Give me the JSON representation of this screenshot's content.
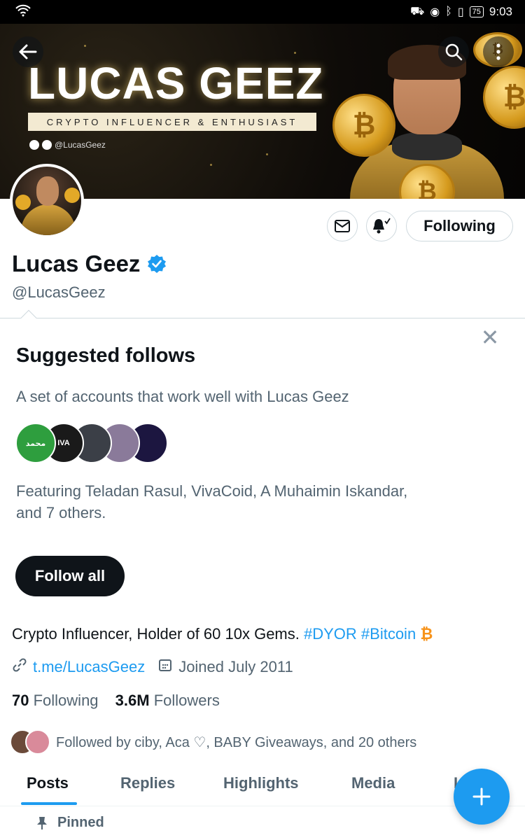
{
  "status_bar": {
    "battery": "75",
    "time": "9:03"
  },
  "banner": {
    "title": "LUCAS GEEZ",
    "tagline": "CRYPTO INFLUENCER & ENTHUSIAST",
    "social_handle": "@LucasGeez"
  },
  "profile": {
    "name": "Lucas Geez",
    "handle": "@LucasGeez",
    "following_button": "Following",
    "bio_text": "Crypto Influencer, Holder of 60 10x Gems. ",
    "bio_tag1": "#DYOR",
    "bio_tag2": "#Bitcoin",
    "bio_emoji": "₿",
    "link": "t.me/LucasGeez",
    "joined": "Joined July 2011",
    "following_count": "70",
    "following_label": "Following",
    "followers_count": "3.6M",
    "followers_label": "Followers",
    "followed_by": "Followed by ciby, Aca ♡, BABY Giveaways, and 20 others"
  },
  "suggested": {
    "title": "Suggested follows",
    "subtitle": "A set of accounts that work well with Lucas Geez",
    "featuring": "Featuring Teladan Rasul, VivaCoid, A Muhaimin Iskandar, and 7 others.",
    "follow_all": "Follow all",
    "avatars": [
      {
        "label": "محمد",
        "color": "#2e9e3e"
      },
      {
        "label": "IVA",
        "color": "#1a1a1a"
      },
      {
        "label": "",
        "color": "#3b3f47"
      },
      {
        "label": "",
        "color": "#8a7a9a"
      },
      {
        "label": "",
        "color": "#1c1640"
      }
    ]
  },
  "tabs": [
    "Posts",
    "Replies",
    "Highlights",
    "Media",
    "L"
  ],
  "pinned_label": "Pinned",
  "colors": {
    "accent": "#1d9bf0",
    "text": "#0f1419",
    "muted": "#536471",
    "bitcoin": "#f7931a"
  }
}
